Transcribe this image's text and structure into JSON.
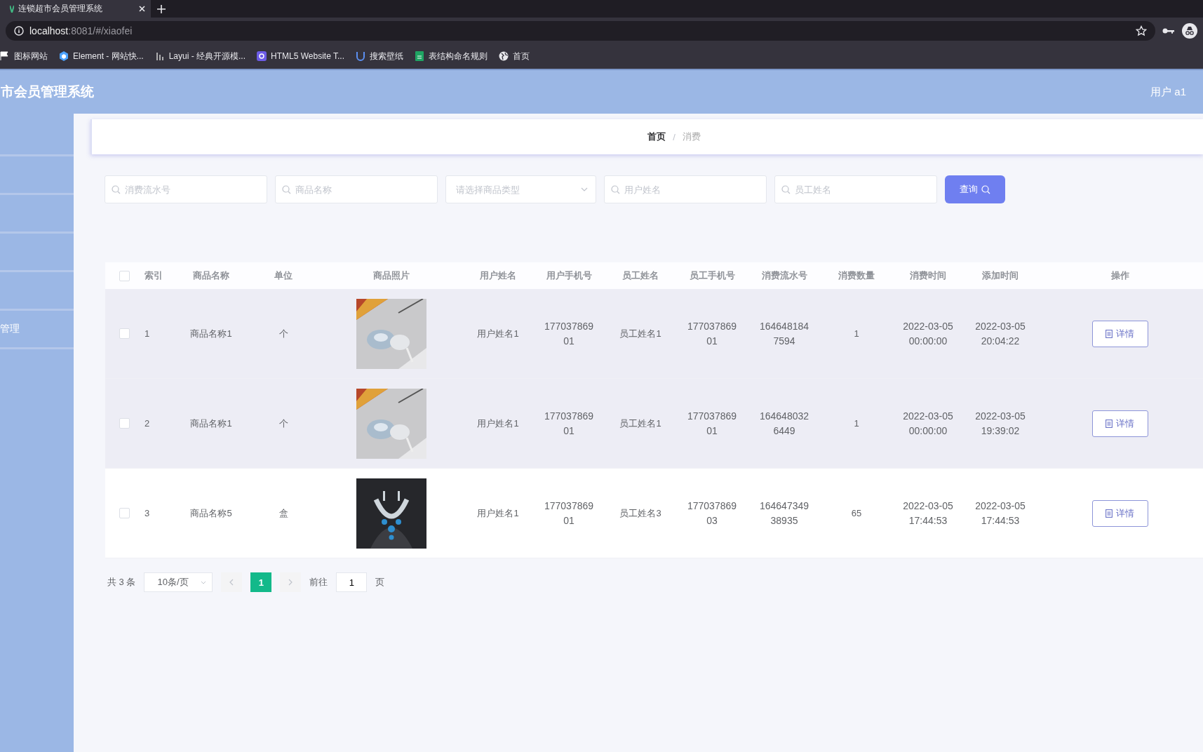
{
  "browser": {
    "tab_title": "连锁超市会员管理系统",
    "url_host": "localhost",
    "url_path": ":8081/#/xiaofei",
    "bookmarks": [
      {
        "label": "图标网站"
      },
      {
        "label": "Element - 网站快..."
      },
      {
        "label": "Layui - 经典开源模..."
      },
      {
        "label": "HTML5 Website T..."
      },
      {
        "label": "搜索壁纸"
      },
      {
        "label": "表结构命名规则"
      },
      {
        "label": "首页"
      }
    ]
  },
  "header": {
    "title": "市会员管理系统",
    "user": "用户 a1"
  },
  "sidebar": {
    "items": [
      {
        "label": "管理"
      }
    ]
  },
  "breadcrumb": {
    "items": [
      {
        "label": "首页"
      },
      {
        "label": "消费"
      }
    ],
    "separator": "/"
  },
  "search": {
    "fields": [
      {
        "kind": "input",
        "placeholder": "消费流水号"
      },
      {
        "kind": "input",
        "placeholder": "商品名称"
      },
      {
        "kind": "select",
        "placeholder": "请选择商品类型"
      },
      {
        "kind": "input",
        "placeholder": "用户姓名"
      },
      {
        "kind": "input",
        "placeholder": "员工姓名"
      }
    ],
    "button": "查询"
  },
  "table": {
    "columns": [
      "索引",
      "商品名称",
      "单位",
      "商品照片",
      "用户姓名",
      "用户手机号",
      "员工姓名",
      "员工手机号",
      "消费流水号",
      "消费数量",
      "消费时间",
      "添加时间",
      "操作"
    ],
    "all_checked": false,
    "rows": [
      {
        "checked": false,
        "highlighted": true,
        "index": "1",
        "name": "商品名称1",
        "unit": "个",
        "photo": {
          "kind": "picture",
          "dark": false
        },
        "user": "用户姓名1",
        "user_phone": "17703786901",
        "staff": "员工姓名1",
        "staff_phone": "17703786901",
        "serial": "1646481847594",
        "qty": "1",
        "time": "2022-03-05 00:00:00",
        "added": "2022-03-05 20:04:22",
        "action": "详情"
      },
      {
        "checked": false,
        "highlighted": true,
        "index": "2",
        "name": "商品名称1",
        "unit": "个",
        "photo": {
          "kind": "picture",
          "dark": false
        },
        "user": "用户姓名1",
        "user_phone": "17703786901",
        "staff": "员工姓名1",
        "staff_phone": "17703786901",
        "serial": "1646480326449",
        "qty": "1",
        "time": "2022-03-05 00:00:00",
        "added": "2022-03-05 19:39:02",
        "action": "详情"
      },
      {
        "checked": false,
        "highlighted": false,
        "index": "3",
        "name": "商品名称5",
        "unit": "盒",
        "photo": {
          "kind": "picture",
          "dark": true
        },
        "user": "用户姓名1",
        "user_phone": "17703786901",
        "staff": "员工姓名3",
        "staff_phone": "17703786903",
        "serial": "16464734938935",
        "qty": "65",
        "time": "2022-03-05 17:44:53",
        "added": "2022-03-05 17:44:53",
        "action": "详情"
      }
    ]
  },
  "pagination": {
    "total": "共 3 条",
    "page_size": "10条/页",
    "pages": [
      {
        "label": "1",
        "selected": true
      }
    ],
    "goto_label": "前往",
    "goto_value": "1",
    "goto_suffix": "页"
  }
}
